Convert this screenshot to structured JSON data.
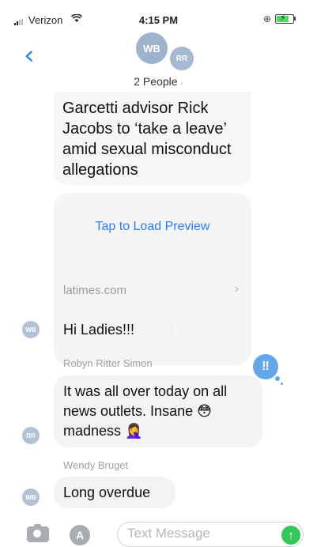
{
  "status_bar": {
    "carrier": "Verizon",
    "wifi_icon": "wifi-icon",
    "time": "4:15 PM",
    "orientation_lock_icon": "orientation-lock-icon",
    "battery_state": "charging",
    "battery_level": 0.7,
    "battery_color": "#4cd964"
  },
  "header": {
    "back_icon": "chevron-left-icon",
    "avatars": [
      {
        "initials": "WB",
        "color": "#9fb2cd"
      },
      {
        "initials": "RR",
        "color": "#a6b8d2"
      }
    ],
    "title": "2 People",
    "title_chevron": "›"
  },
  "link_preview": {
    "title": "Garcetti advisor Rick Jacobs to ‘take a leave’ amid sexual misconduct allegations",
    "action": "Tap to Load Preview",
    "domain": "latimes.com",
    "chevron": "›"
  },
  "messages": [
    {
      "avatar": "WB",
      "text": "Hi Ladies!!!"
    },
    {
      "sender": "Robyn Ritter Simon",
      "avatar": "RR",
      "text": "It was all over today on all news outlets. Insane 😳 madness 🤦‍♀️",
      "reaction": "‼"
    },
    {
      "sender": "Wendy Bruget",
      "avatar": "WB",
      "text": "Long overdue"
    }
  ],
  "composer": {
    "camera_icon": "camera-icon",
    "apps_icon": "app-store-icon",
    "placeholder": "Text Message",
    "send_icon": "send-arrow-icon",
    "send_glyph": "↑"
  },
  "colors": {
    "accent": "#2b7cf6",
    "bubble": "#f2f3f5",
    "send": "#34c759",
    "reaction": "#62a6e9"
  }
}
